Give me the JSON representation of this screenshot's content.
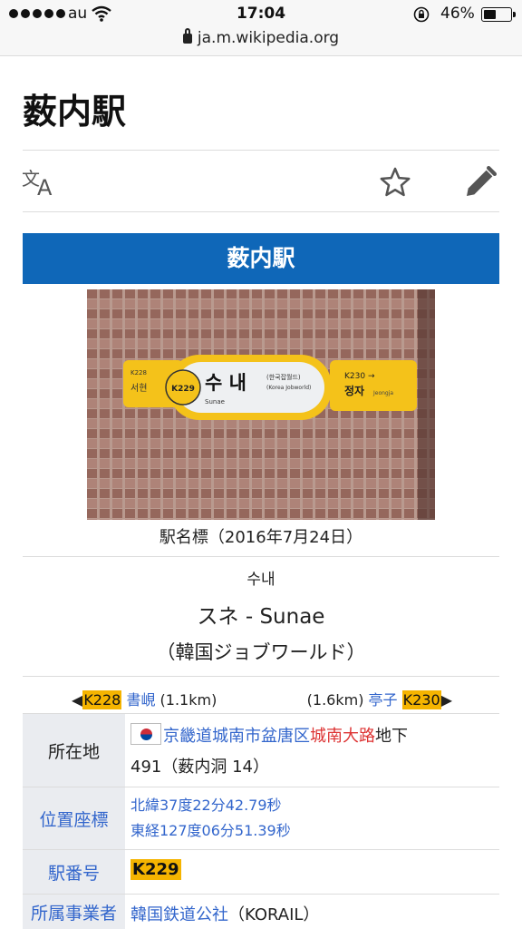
{
  "status_bar": {
    "carrier": "au",
    "time": "17:04",
    "battery": "46%",
    "battery_level": 0.46
  },
  "url_bar": {
    "domain": "ja.m.wikipedia.org"
  },
  "page": {
    "title": "薮内駅",
    "icons": [
      "language-icon",
      "star-icon",
      "edit-icon"
    ]
  },
  "infobox": {
    "header": "薮内駅",
    "photo_sign": {
      "code": "K229",
      "hangul": "수  내",
      "sub": "(한국잡월드)",
      "sub2": "(Korea Jobworld)",
      "roman": "Sunae",
      "next_code": "K230 →",
      "next_hangul": "정자",
      "next_roman": "Jeongja"
    },
    "caption": "駅名標（2016年7月24日）",
    "name_ko": "수내",
    "name_kana": "スネ - Sunae",
    "name_sub": "（韓国ジョブワールド）",
    "adjacent": {
      "prev_arrow": "◀",
      "prev_code": "K228",
      "prev_name": "書峴",
      "prev_dist": "(1.1km)",
      "next_dist": "(1.6km)",
      "next_name": "亭子",
      "next_code": "K230",
      "next_arrow": "▶"
    },
    "rows": {
      "location": {
        "label": "所在地",
        "link1": "京畿道城南市盆唐区",
        "redlink": "城南大路",
        "suffix": "地下",
        "line2": "491（薮内洞 14）"
      },
      "coords": {
        "label": "位置座標",
        "lat": "北緯37度22分42.79秒",
        "lon": "東経127度06分51.39秒"
      },
      "station_number": {
        "label": "駅番号",
        "value": "K229"
      },
      "operator": {
        "label": "所属事業者",
        "value": "韓国鉄道公社",
        "suffix": "（KORAIL）"
      }
    }
  },
  "colors": {
    "header_blue": "#0f67b8",
    "code_yellow": "#f5b400",
    "link_blue": "#3366cc",
    "redlink": "#dd3333",
    "label_bg": "#eaecf0"
  }
}
